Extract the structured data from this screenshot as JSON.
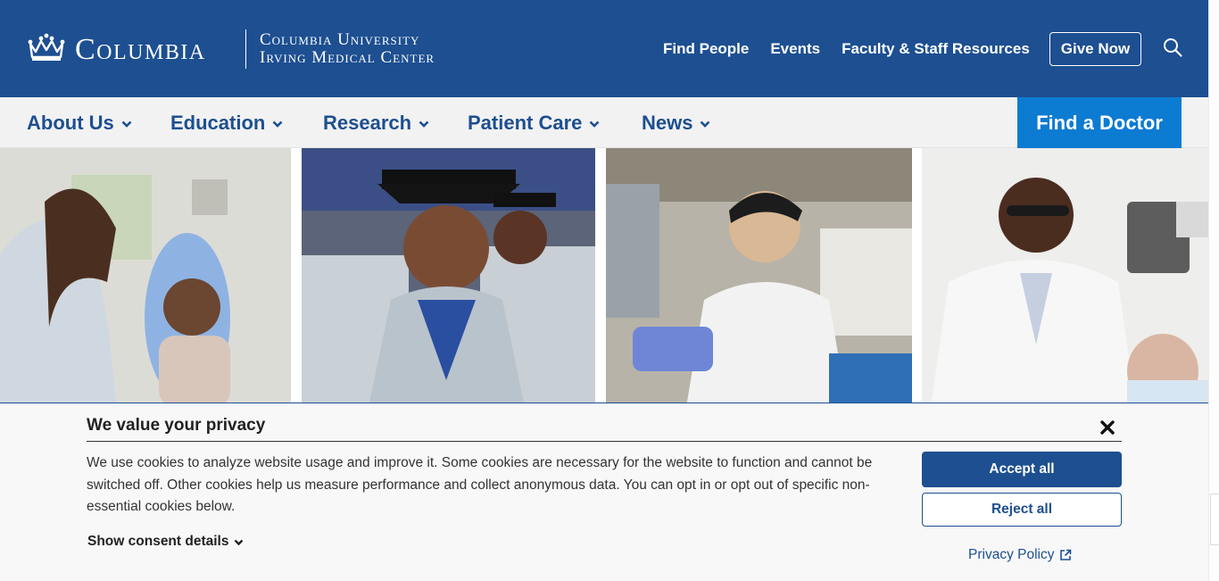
{
  "header": {
    "logo_word": "Columbia",
    "logo_sub_line1": "Columbia University",
    "logo_sub_line2": "Irving Medical Center",
    "utility_links": [
      "Find People",
      "Events",
      "Faculty & Staff Resources"
    ],
    "give_label": "Give Now",
    "search_icon": "search-icon",
    "colors": {
      "brand": "#1d4f91",
      "accent": "#0c7bd2"
    }
  },
  "nav": {
    "items": [
      "About Us",
      "Education",
      "Research",
      "Patient Care",
      "News"
    ],
    "cta_label": "Find a Doctor"
  },
  "consent": {
    "title": "We value your privacy",
    "text": "We use cookies to analyze website usage and improve it. Some cookies are necessary for the website to function and cannot be switched off. Other cookies help us measure performance and collect anonymous data. You can opt in or opt out of specific non-essential cookies below.",
    "details_label": "Show consent details",
    "accept_label": "Accept all",
    "reject_label": "Reject all",
    "privacy_label": "Privacy Policy"
  }
}
